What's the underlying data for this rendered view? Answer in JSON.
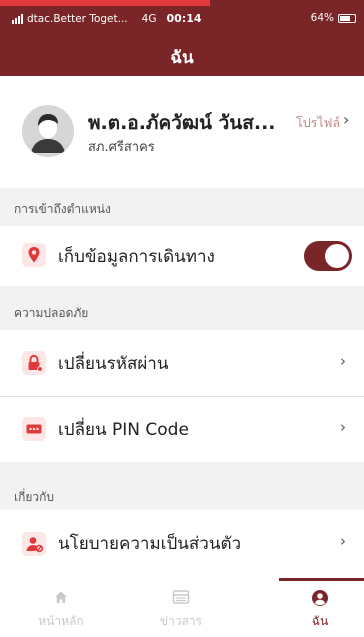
{
  "status_bar": {
    "carrier": "dtac.Better Toget...",
    "network": "4G",
    "time": "00:14",
    "battery": "64%"
  },
  "header": {
    "title": "ฉัน",
    "color": "#7a2527"
  },
  "profile": {
    "name": "พ.ต.อ.ภัควัฒน์ วันส...",
    "station": "สภ.ศรีสาคร",
    "link_label": "โปรไฟล์",
    "chevron": "›"
  },
  "sections": {
    "location": {
      "label": "การเข้าถึงตำแหน่ง",
      "item_label": "เก็บข้อมูลการเดินทาง",
      "icon": "location-pin-icon",
      "toggle_on": true
    },
    "security": {
      "label": "ความปลอดภัย",
      "items": [
        {
          "label": "เปลี่ยนรหัสผ่าน",
          "icon": "lock-icon",
          "chevron": "›"
        },
        {
          "label": "เปลี่ยน PIN Code",
          "icon": "pin-code-icon",
          "chevron": "›"
        }
      ]
    },
    "about": {
      "label": "เกี่ยวกับ",
      "items": [
        {
          "label": "นโยบายความเป็นส่วนตัว",
          "icon": "privacy-policy-icon",
          "chevron": "›"
        }
      ]
    }
  },
  "tabbar": {
    "tabs": [
      {
        "label": "หน้าหลัก",
        "icon": "home-icon",
        "active": false
      },
      {
        "label": "ข่าวสาร",
        "icon": "news-icon",
        "active": false
      },
      {
        "label": "ฉัน",
        "icon": "user-circle-icon",
        "active": true
      }
    ]
  },
  "colors": {
    "brand": "#7a2527",
    "icon_red": "#e0393a",
    "inactive_tab": "#c9c9c9"
  }
}
